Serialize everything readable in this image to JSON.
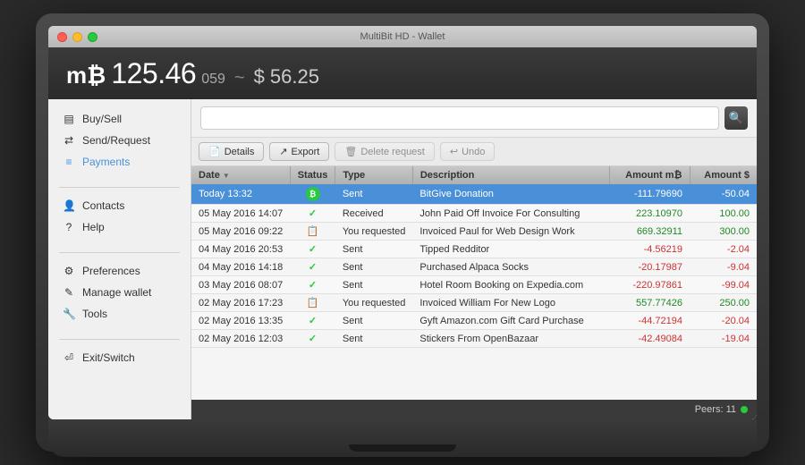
{
  "window": {
    "title": "MultiBit HD - Wallet"
  },
  "header": {
    "balance_icon": "m₿",
    "balance_main": "125.46",
    "balance_milli": "059",
    "balance_sep": "~",
    "balance_usd": "$ 56.25"
  },
  "sidebar": {
    "sections": [
      {
        "items": [
          {
            "id": "buy-sell",
            "label": "Buy/Sell",
            "icon": "▤",
            "active": false
          },
          {
            "id": "send-request",
            "label": "Send/Request",
            "icon": "⇄",
            "active": false
          },
          {
            "id": "payments",
            "label": "Payments",
            "icon": "≡",
            "active": true
          }
        ]
      },
      {
        "items": [
          {
            "id": "contacts",
            "label": "Contacts",
            "icon": "👤",
            "active": false
          },
          {
            "id": "help",
            "label": "Help",
            "icon": "?",
            "active": false
          }
        ]
      },
      {
        "items": [
          {
            "id": "preferences",
            "label": "Preferences",
            "icon": "⚙",
            "active": false
          },
          {
            "id": "manage-wallet",
            "label": "Manage wallet",
            "icon": "✎",
            "active": false
          },
          {
            "id": "tools",
            "label": "Tools",
            "icon": "🔧",
            "active": false
          }
        ]
      },
      {
        "items": [
          {
            "id": "exit-switch",
            "label": "Exit/Switch",
            "icon": "⏎",
            "active": false
          }
        ]
      }
    ]
  },
  "toolbar": {
    "search_placeholder": "",
    "search_icon": "🔍",
    "buttons": {
      "details": "Details",
      "export": "Export",
      "delete": "Delete request",
      "undo": "Undo"
    }
  },
  "table": {
    "columns": [
      "Date",
      "Status",
      "Type",
      "Description",
      "Amount m₿",
      "Amount $"
    ],
    "rows": [
      {
        "date": "Today 13:32",
        "status": "bitcoin",
        "type": "Sent",
        "description": "BitGive Donation",
        "amount_btc": "-111.79690",
        "amount_usd": "-50.04",
        "selected": true
      },
      {
        "date": "05 May 2016 14:07",
        "status": "check",
        "type": "Received",
        "description": "John Paid Off Invoice For Consulting",
        "amount_btc": "223.10970",
        "amount_usd": "100.00",
        "selected": false
      },
      {
        "date": "05 May 2016 09:22",
        "status": "doc",
        "type": "You requested",
        "description": "Invoiced Paul for Web Design Work",
        "amount_btc": "669.32911",
        "amount_usd": "300.00",
        "selected": false
      },
      {
        "date": "04 May 2016 20:53",
        "status": "check",
        "type": "Sent",
        "description": "Tipped Redditor",
        "amount_btc": "-4.56219",
        "amount_usd": "-2.04",
        "selected": false
      },
      {
        "date": "04 May 2016 14:18",
        "status": "check",
        "type": "Sent",
        "description": "Purchased Alpaca Socks",
        "amount_btc": "-20.17987",
        "amount_usd": "-9.04",
        "selected": false
      },
      {
        "date": "03 May 2016 08:07",
        "status": "check",
        "type": "Sent",
        "description": "Hotel Room Booking on Expedia.com",
        "amount_btc": "-220.97861",
        "amount_usd": "-99.04",
        "selected": false
      },
      {
        "date": "02 May 2016 17:23",
        "status": "doc",
        "type": "You requested",
        "description": "Invoiced William For New Logo",
        "amount_btc": "557.77426",
        "amount_usd": "250.00",
        "selected": false
      },
      {
        "date": "02 May 2016 13:35",
        "status": "check",
        "type": "Sent",
        "description": "Gyft Amazon.com Gift Card Purchase",
        "amount_btc": "-44.72194",
        "amount_usd": "-20.04",
        "selected": false
      },
      {
        "date": "02 May 2016 12:03",
        "status": "check",
        "type": "Sent",
        "description": "Stickers From OpenBazaar",
        "amount_btc": "-42.49084",
        "amount_usd": "-19.04",
        "selected": false
      }
    ]
  },
  "status_bar": {
    "peers_label": "Peers: 11"
  }
}
